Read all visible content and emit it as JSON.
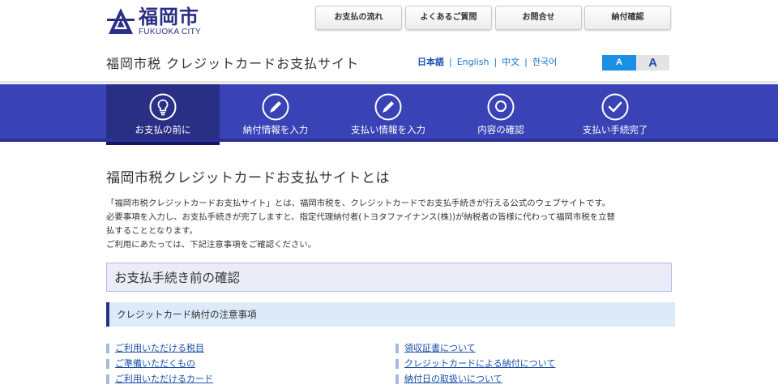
{
  "header": {
    "logo": {
      "name": "福岡市",
      "sub": "FUKUOKA CITY",
      "icon": "city-emblem-icon"
    },
    "top_nav": [
      "お支払の流れ",
      "よくあるご質問",
      "お問合せ",
      "納付確認"
    ],
    "site_title": "福岡市税 クレジットカードお支払サイト",
    "languages": [
      {
        "label": "日本語",
        "active": true
      },
      {
        "label": "English",
        "active": false
      },
      {
        "label": "中文",
        "active": false
      },
      {
        "label": "한국어",
        "active": false
      }
    ],
    "font_size": {
      "small": "A",
      "large": "A"
    }
  },
  "steps": [
    {
      "label": "お支払の前に",
      "icon": "lightbulb-icon",
      "active": true
    },
    {
      "label": "納付情報を入力",
      "icon": "pencil-icon",
      "active": false
    },
    {
      "label": "支払い情報を入力",
      "icon": "pencil-icon",
      "active": false
    },
    {
      "label": "内容の確認",
      "icon": "magnifier-icon",
      "active": false
    },
    {
      "label": "支払い手続完了",
      "icon": "checkmark-icon",
      "active": false
    }
  ],
  "main": {
    "heading": "福岡市税クレジットカードお支払サイトとは",
    "intro": [
      "「福岡市税クレジットカードお支払サイト」とは、福岡市税を、クレジットカードでお支払手続きが行える公式のウェブサイトです。",
      "必要事項を入力し、お支払手続きが完了しますと、指定代理納付者(トヨタファイナンス(株))が納税者の皆様に代わって福岡市税を立替",
      "払することとなります。",
      "ご利用にあたっては、下記注意事項をご確認ください。"
    ],
    "section_title": "お支払手続き前の確認",
    "sub_title": "クレジットカード納付の注意事項",
    "links_left": [
      "ご利用いただける税目",
      "ご準備いただくもの",
      "ご利用いただけるカード"
    ],
    "links_right": [
      "領収証書について",
      "クレジットカードによる納付について",
      "納付日の取扱いについて"
    ]
  },
  "colors": {
    "brand_navy": "#2a2f86",
    "steps_band": "#3a43b5",
    "link": "#1a4fa8",
    "lang_link": "#1a73c8",
    "font_small_btn": "#1a8fe6"
  }
}
